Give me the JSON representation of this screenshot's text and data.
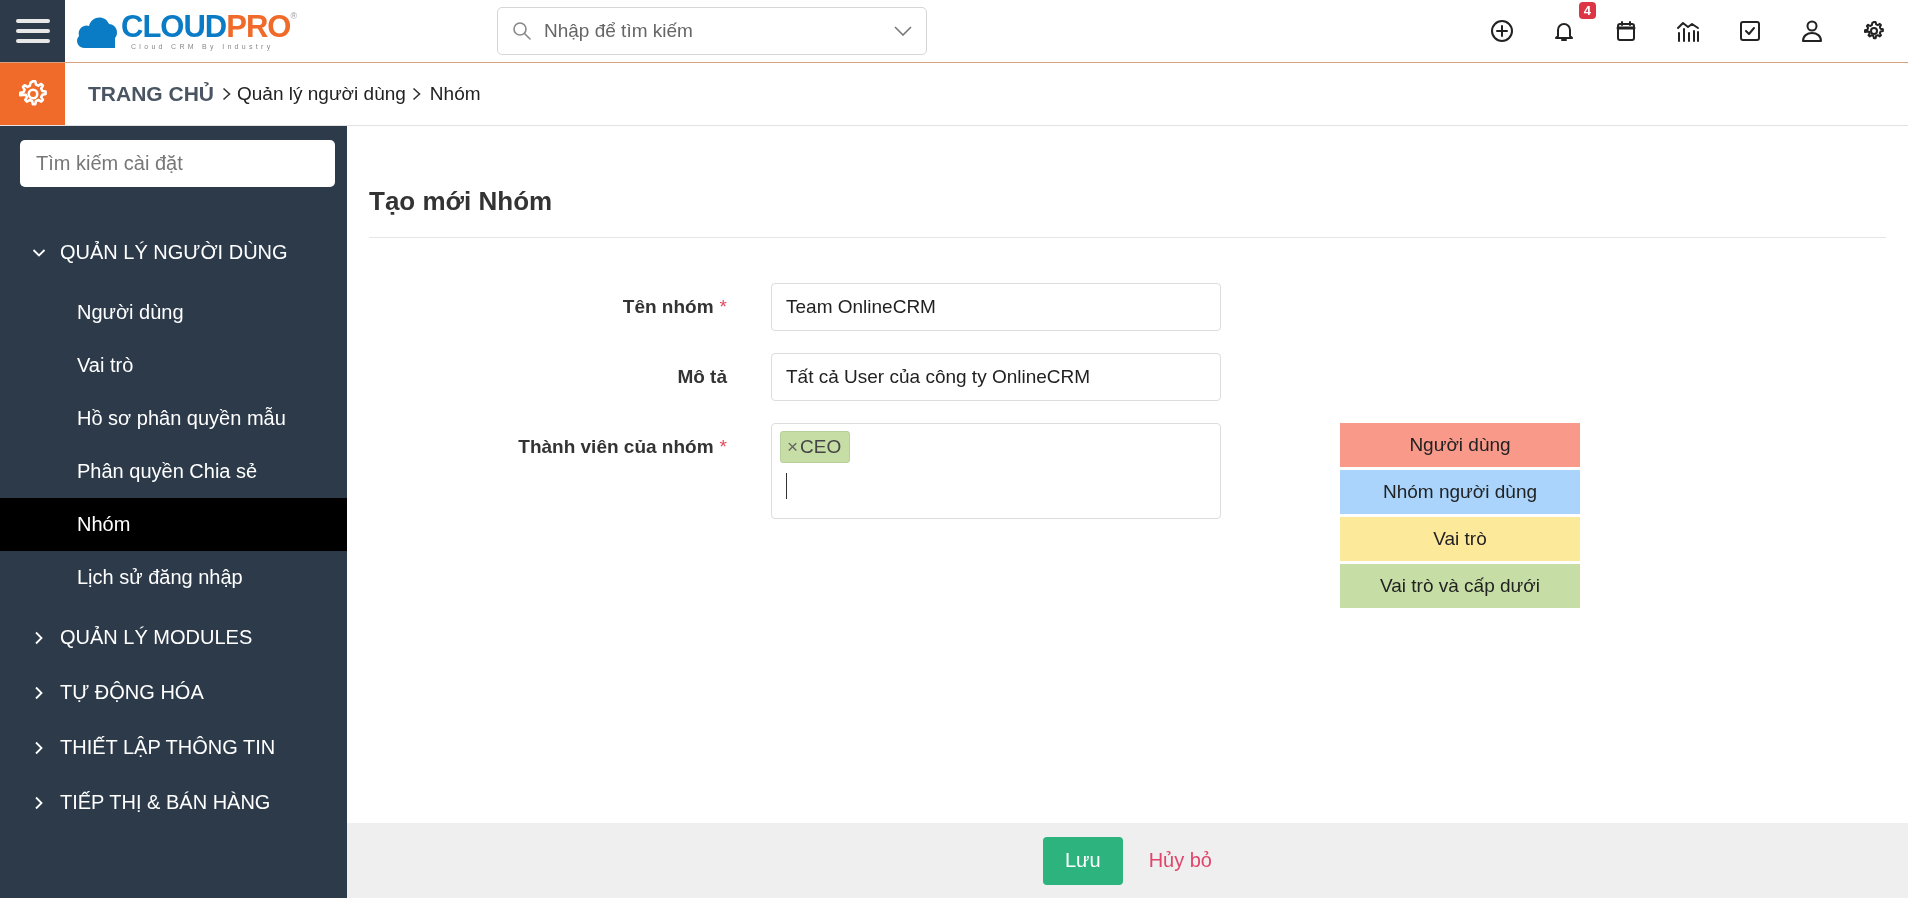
{
  "logo": {
    "brand_primary": "CLOUD",
    "brand_accent": "PRO",
    "registered_mark": "®",
    "tagline": "Cloud CRM By Industry"
  },
  "search": {
    "placeholder": "Nhập để tìm kiếm"
  },
  "notifications": {
    "badge": "4"
  },
  "breadcrumb": [
    "TRANG CHỦ",
    "Quản lý người dùng",
    "Nhóm"
  ],
  "sidebar": {
    "search_placeholder": "Tìm kiếm cài đặt",
    "sections": [
      {
        "label": "QUẢN LÝ NGƯỜI DÙNG",
        "expanded": true,
        "children": [
          {
            "label": "Người dùng",
            "selected": false
          },
          {
            "label": "Vai trò",
            "selected": false
          },
          {
            "label": "Hồ sơ phân quyền mẫu",
            "selected": false
          },
          {
            "label": "Phân quyền Chia sẻ",
            "selected": false
          },
          {
            "label": "Nhóm",
            "selected": true
          },
          {
            "label": "Lịch sử đăng nhập",
            "selected": false
          }
        ]
      },
      {
        "label": "QUẢN LÝ MODULES",
        "expanded": false
      },
      {
        "label": "TỰ ĐỘNG HÓA",
        "expanded": false
      },
      {
        "label": "THIẾT LẬP THÔNG TIN",
        "expanded": false
      },
      {
        "label": "TIẾP THỊ & BÁN HÀNG",
        "expanded": false
      }
    ]
  },
  "form": {
    "title": "Tạo mới Nhóm",
    "fields": [
      {
        "kind": "text",
        "label": "Tên nhóm",
        "required_mark": "*",
        "value": "Team OnlineCRM"
      },
      {
        "kind": "text",
        "label": "Mô tả",
        "value": "Tất cả User của công ty OnlineCRM"
      },
      {
        "kind": "tags",
        "label": "Thành viên của nhóm",
        "required_mark": "*",
        "tags": [
          {
            "remove": "×",
            "label": "CEO",
            "color": "#c6dea6"
          }
        ]
      }
    ],
    "legend": [
      {
        "label": "Người dùng",
        "color": "#f8998a"
      },
      {
        "label": "Nhóm người dùng",
        "color": "#aad4fb"
      },
      {
        "label": "Vai trò",
        "color": "#fde99a"
      },
      {
        "label": "Vai trò và cấp dưới",
        "color": "#c6dea6"
      }
    ]
  },
  "footer": {
    "save": "Lưu",
    "cancel": "Hủy bỏ"
  }
}
